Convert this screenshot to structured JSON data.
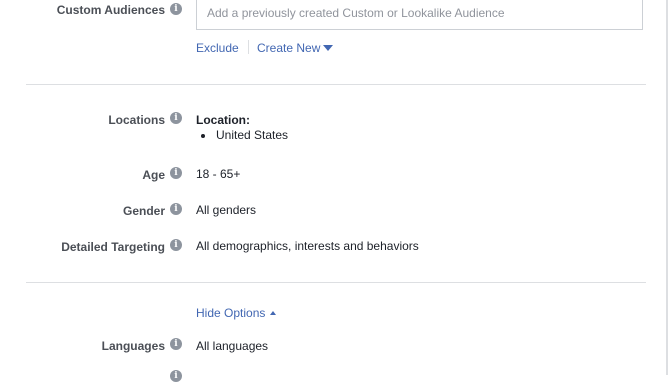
{
  "custom_audiences": {
    "label": "Custom Audiences",
    "placeholder": "Add a previously created Custom or Lookalike Audience",
    "exclude_label": "Exclude",
    "create_new_label": "Create New"
  },
  "locations": {
    "label": "Locations",
    "heading": "Location:",
    "items": [
      "United States"
    ]
  },
  "age": {
    "label": "Age",
    "value": "18 - 65+"
  },
  "gender": {
    "label": "Gender",
    "value": "All genders"
  },
  "detailed_targeting": {
    "label": "Detailed Targeting",
    "value": "All demographics, interests and behaviors"
  },
  "options": {
    "hide_options_label": "Hide Options"
  },
  "languages": {
    "label": "Languages",
    "value": "All languages"
  },
  "colors": {
    "link": "#4267b2",
    "label": "#4b4f56",
    "text": "#1d2129",
    "icon": "#8d949e",
    "divider": "#dddfe2"
  }
}
